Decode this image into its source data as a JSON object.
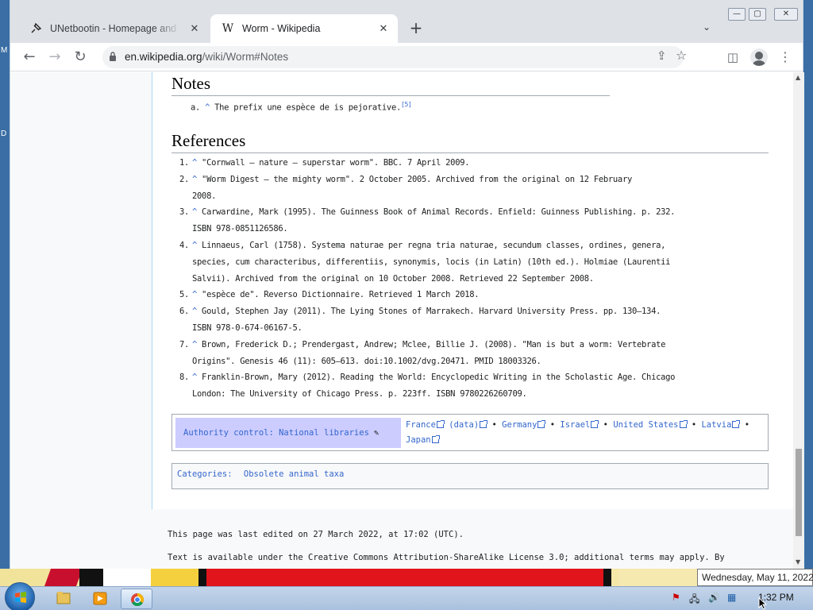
{
  "browser": {
    "tabs": [
      {
        "title": "UNetbootin - Homepage and Do",
        "icon": "pin-icon",
        "active": false
      },
      {
        "title": "Worm - Wikipedia",
        "icon": "wikipedia-w-icon",
        "active": true
      }
    ],
    "url_host": "en.wikipedia.org",
    "url_path": "/wiki/Worm#Notes"
  },
  "article": {
    "notes_heading": "Notes",
    "note": {
      "marker": "a.",
      "caret": "^",
      "text": "The prefix une espèce de is pejorative.",
      "cite": "[5]"
    },
    "references_heading": "References",
    "references": [
      {
        "num": "1.",
        "lines": [
          "\"Cornwall – nature – superstar worm\". BBC. 7 April 2009."
        ]
      },
      {
        "num": "2.",
        "lines": [
          "\"Worm Digest – the mighty worm\". 2 October 2005. Archived from the original on 12 February",
          "2008."
        ]
      },
      {
        "num": "3.",
        "lines": [
          "Carwardine, Mark (1995). The Guinness Book of Animal Records. Enfield: Guinness Publishing. p. 232.",
          "ISBN 978-0851126586."
        ]
      },
      {
        "num": "4.",
        "lines": [
          "Linnaeus, Carl (1758). Systema naturae per regna tria naturae, secundum classes, ordines, genera,",
          "species, cum characteribus, differentiis, synonymis, locis (in Latin) (10th ed.). Holmiae (Laurentii",
          "Salvii). Archived from the original on 10 October 2008. Retrieved 22 September 2008."
        ]
      },
      {
        "num": "5.",
        "lines": [
          "\"espèce de\". Reverso Dictionnaire. Retrieved 1 March 2018."
        ]
      },
      {
        "num": "6.",
        "lines": [
          "Gould, Stephen Jay (2011). The Lying Stones of Marrakech. Harvard University Press. pp. 130–134.",
          "ISBN 978-0-674-06167-5."
        ]
      },
      {
        "num": "7.",
        "lines": [
          "Brown, Frederick D.; Prendergast, Andrew; Mclee, Billie J. (2008). \"Man is but a worm: Vertebrate",
          "Origins\". Genesis 46 (11): 605–613. doi:10.1002/dvg.20471. PMID 18003326."
        ]
      },
      {
        "num": "8.",
        "lines": [
          "Franklin-Brown, Mary (2012). Reading the World: Encyclopedic Writing in the Scholastic Age. Chicago",
          "London: The University of Chicago Press. p. 223ff. ISBN 9780226260709."
        ]
      }
    ],
    "authority": {
      "title": "Authority control: National libraries",
      "items": [
        "France",
        "(data)",
        "Germany",
        "Israel",
        "United States",
        "Latvia",
        "Japan"
      ]
    },
    "categories": {
      "label": "Categories:",
      "items": [
        "Obsolete animal taxa"
      ]
    },
    "footer": {
      "last_edited": "This page was last edited on 27 March 2022, at 17:02 (UTC).",
      "license": "Text is available under the Creative Commons Attribution-ShareAlike License 3.0; additional terms may apply. By"
    }
  },
  "taskbar": {
    "time": "1:32 PM",
    "date_tooltip": "Wednesday, May 11, 2022"
  },
  "colors": {
    "link": "#3366cc",
    "tab_strip": "#dee1e6",
    "navbox_title": "#ccccff"
  }
}
